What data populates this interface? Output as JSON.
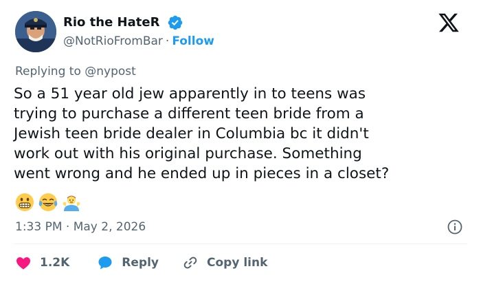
{
  "author": {
    "name": "Rio the HateR",
    "handle": "@NotRioFromBar",
    "separator": "·",
    "follow_label": "Follow"
  },
  "reply_to": {
    "prefix": "Replying to ",
    "mention": "@nypost"
  },
  "tweet": {
    "lines": [
      "So a 51 year old jew apparently in to teens was",
      "trying to purchase a different teen bride from a",
      "Jewish teen bride dealer in Columbia bc it didn't",
      "work out with his original purchase. Something",
      "went wrong and he ended up in pieces in a closet?"
    ],
    "emojis": [
      "grimacing-face",
      "face-with-tears-of-joy",
      "man-shrugging"
    ]
  },
  "timestamp": {
    "time": "1:33 PM",
    "separator": "·",
    "date": "May 2, 2026"
  },
  "actions": {
    "like_count": "1.2K",
    "reply_label": "Reply",
    "copy_label": "Copy link"
  },
  "colors": {
    "accent": "#1d9bf0",
    "muted": "#536471",
    "like": "#f91880",
    "text": "#0f1419"
  }
}
